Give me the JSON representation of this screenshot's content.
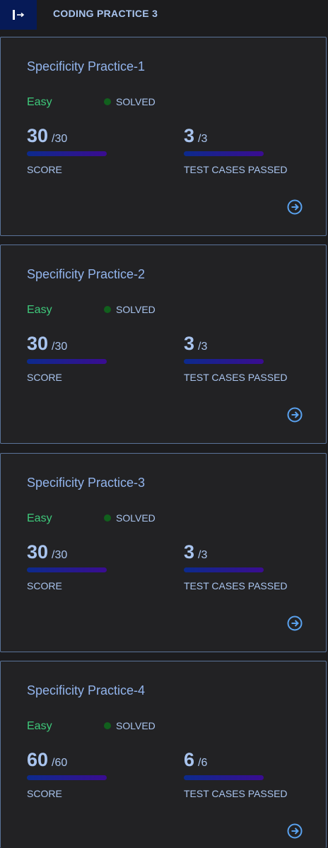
{
  "header": {
    "title": "CODING PRACTICE 3",
    "toggle_icon": "sidebar-toggle-icon"
  },
  "colors": {
    "toggle_bg": "#061a57",
    "difficulty_easy": "#3ec87a",
    "solved_dot": "#11601d",
    "progress_bar": "#0c2a8c",
    "card_border": "#5a7399"
  },
  "cards": [
    {
      "title": "Specificity Practice-1",
      "difficulty": "Easy",
      "status": "SOLVED",
      "score": {
        "value": "30",
        "total": "/30",
        "label": "SCORE",
        "fraction": 1.0
      },
      "tests": {
        "value": "3",
        "total": "/3",
        "label": "TEST CASES PASSED",
        "fraction": 1.0
      }
    },
    {
      "title": "Specificity Practice-2",
      "difficulty": "Easy",
      "status": "SOLVED",
      "score": {
        "value": "30",
        "total": "/30",
        "label": "SCORE",
        "fraction": 1.0
      },
      "tests": {
        "value": "3",
        "total": "/3",
        "label": "TEST CASES PASSED",
        "fraction": 1.0
      }
    },
    {
      "title": "Specificity Practice-3",
      "difficulty": "Easy",
      "status": "SOLVED",
      "score": {
        "value": "30",
        "total": "/30",
        "label": "SCORE",
        "fraction": 1.0
      },
      "tests": {
        "value": "3",
        "total": "/3",
        "label": "TEST CASES PASSED",
        "fraction": 1.0
      }
    },
    {
      "title": "Specificity Practice-4",
      "difficulty": "Easy",
      "status": "SOLVED",
      "score": {
        "value": "60",
        "total": "/60",
        "label": "SCORE",
        "fraction": 1.0
      },
      "tests": {
        "value": "6",
        "total": "/6",
        "label": "TEST CASES PASSED",
        "fraction": 1.0
      }
    }
  ]
}
